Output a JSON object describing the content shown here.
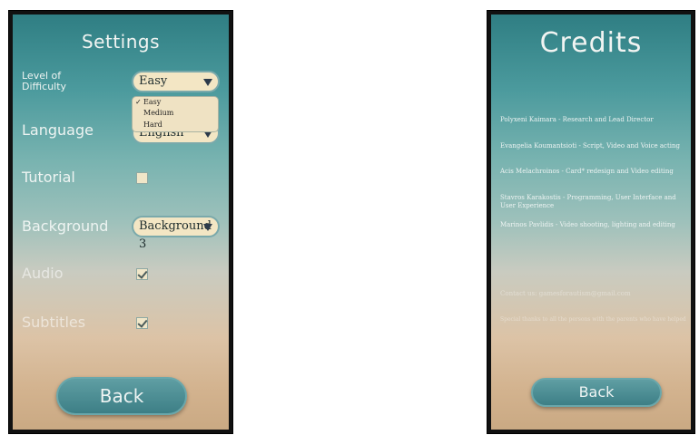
{
  "settings": {
    "title": "Settings",
    "difficulty": {
      "label": "Level of Difficulty",
      "selected": "Easy",
      "options": [
        "Easy",
        "Medium",
        "Hard"
      ]
    },
    "language": {
      "label": "Language",
      "value": "English"
    },
    "tutorial": {
      "label": "Tutorial",
      "checked": false
    },
    "background": {
      "label": "Background",
      "value": "Background 3"
    },
    "audio": {
      "label": "Audio",
      "checked": true
    },
    "subtitles": {
      "label": "Subtitles",
      "checked": true
    },
    "back_label": "Back"
  },
  "credits": {
    "title": "Credits",
    "lines": [
      "Polyxeni Kaimara - Research and Lead Director",
      "Evangelia Koumantsioti - Script, Video and Voice acting",
      "Acis Melachroinos - Card* redesign and Video editing",
      "Stavros Karakostis - Programming, User Interface and User Experience",
      "Marinos Pavlidis - Video shooting, lighting and editing"
    ],
    "faint_lines": [
      "Contact us: gamesforautism@gmail.com",
      "Special thanks to all the persons with the parents who have helped"
    ],
    "back_label": "Back"
  }
}
